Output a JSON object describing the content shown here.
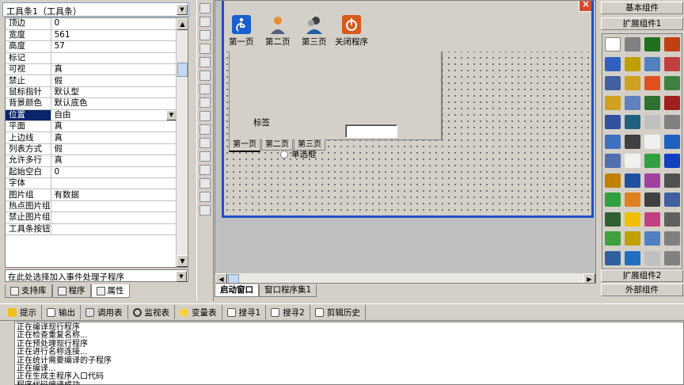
{
  "property_panel": {
    "object_select": "工具条1（工具条）",
    "rows": [
      {
        "key": "顶边",
        "value": "0"
      },
      {
        "key": "宽度",
        "value": "561"
      },
      {
        "key": "高度",
        "value": "57"
      },
      {
        "key": "标记",
        "value": ""
      },
      {
        "key": "可视",
        "value": "真"
      },
      {
        "key": "禁止",
        "value": "假"
      },
      {
        "key": "鼠标指针",
        "value": "默认型"
      },
      {
        "key": "背景颜色",
        "value": "默认底色"
      },
      {
        "key": "位置",
        "value": "自由"
      },
      {
        "key": "平面",
        "value": "真"
      },
      {
        "key": "上边线",
        "value": "真"
      },
      {
        "key": "列表方式",
        "value": "假"
      },
      {
        "key": "允许多行",
        "value": "真"
      },
      {
        "key": "起始空白",
        "value": "0"
      },
      {
        "key": "字体",
        "value": ""
      },
      {
        "key": "图片组",
        "value": "有数据"
      },
      {
        "key": "热点图片组",
        "value": ""
      },
      {
        "key": "禁止图片组",
        "value": ""
      },
      {
        "key": "工具条按钮",
        "value": ""
      }
    ],
    "event_select": "在此处选择加入事件处理子程序",
    "tabs": [
      "支持库",
      "程序",
      "属性"
    ]
  },
  "form": {
    "toolbar_buttons": [
      {
        "label": "第一页",
        "icon": "accessibility-icon",
        "color": "#1a5fd0"
      },
      {
        "label": "第二页",
        "icon": "user-icon",
        "color": "#e89030"
      },
      {
        "label": "第三页",
        "icon": "users-group-icon",
        "color": "#404040"
      },
      {
        "label": "关闭程序",
        "icon": "power-icon",
        "color": "#d85a1c"
      }
    ],
    "label_text": "标签",
    "radio_text": "单选框",
    "tabs": [
      "第一页",
      "第二页",
      "第三页"
    ],
    "close_glyph": "×"
  },
  "designer_tabs": [
    "启动窗口",
    "窗口程序集1"
  ],
  "components": {
    "header_basic": "基本组件",
    "header_ext1": "扩展组件1",
    "header_ext2": "扩展组件2",
    "header_external": "外部组件"
  },
  "output": {
    "tabs": [
      "提示",
      "输出",
      "调用表",
      "监视表",
      "变量表",
      "搜寻1",
      "搜寻2",
      "剪辑历史"
    ],
    "lines": [
      "正在编译现行程序",
      "正在检查重复名称...",
      "正在预处理现行程序",
      "正在进行名称连接...",
      "正在统计需要编译的子程序",
      "正在编译...",
      "正在生成主程序入口代码",
      "程序代码编译成功"
    ]
  },
  "colors": {
    "selection": "#0a246a",
    "form_border": "#2050c8",
    "panel_bg": "#d4d0c8"
  }
}
